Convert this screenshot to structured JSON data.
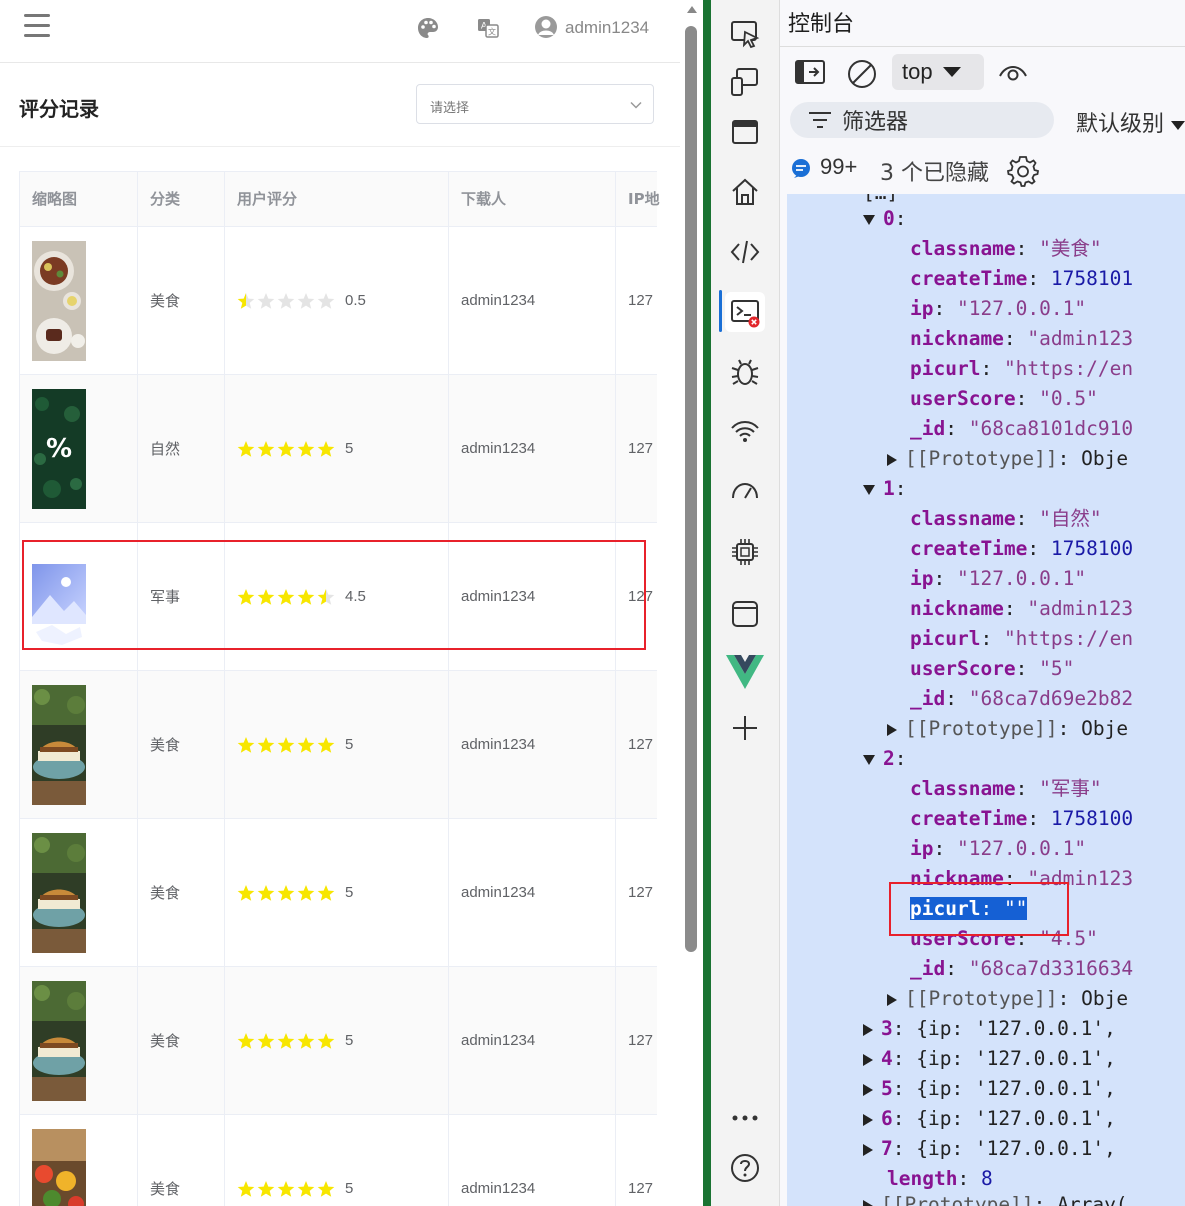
{
  "topbar": {
    "menu_icon": "hamburger-icon",
    "theme_icon": "palette-icon",
    "lang_icon": "translate-icon",
    "user_icon": "user-avatar-icon",
    "username": "admin1234"
  },
  "page": {
    "title": "评分记录",
    "filter_placeholder": "请选择"
  },
  "table": {
    "columns": [
      "缩略图",
      "分类",
      "用户评分",
      "下载人",
      "IP地"
    ],
    "rows": [
      {
        "category": "美食",
        "score": "0.5",
        "stars": 0.5,
        "downloader": "admin1234",
        "ip": "127",
        "thumb": "food"
      },
      {
        "category": "自然",
        "score": "5",
        "stars": 5,
        "downloader": "admin1234",
        "ip": "127",
        "thumb": "nature"
      },
      {
        "category": "军事",
        "score": "4.5",
        "stars": 4.5,
        "downloader": "admin1234",
        "ip": "127",
        "thumb": "placeholder"
      },
      {
        "category": "美食",
        "score": "5",
        "stars": 5,
        "downloader": "admin1234",
        "ip": "127",
        "thumb": "burger"
      },
      {
        "category": "美食",
        "score": "5",
        "stars": 5,
        "downloader": "admin1234",
        "ip": "127",
        "thumb": "burger"
      },
      {
        "category": "美食",
        "score": "5",
        "stars": 5,
        "downloader": "admin1234",
        "ip": "127",
        "thumb": "burger"
      },
      {
        "category": "美食",
        "score": "5",
        "stars": 5,
        "downloader": "admin1234",
        "ip": "127",
        "thumb": "veggies"
      }
    ]
  },
  "colors": {
    "star_on": "#f7e600",
    "star_off": "#e4e4e4",
    "highlight": "#e8212b",
    "devtools_accent": "#1a6fd6"
  },
  "devtools": {
    "title": "控制台",
    "context": "top",
    "filter_label": "筛选器",
    "level": "默认级别",
    "issues": "99+",
    "hidden": "3 个已隐藏",
    "activity_icons": [
      "inspect-icon",
      "device-icon",
      "panel-icon",
      "home-icon",
      "elements-icon",
      "console-icon",
      "bug-icon",
      "network-icon",
      "performance-icon",
      "memory-icon",
      "application-icon",
      "vue-icon",
      "add-icon",
      "more-icon",
      "help-icon"
    ],
    "console_lines": {
      "head": "[…] ",
      "i0": "0",
      "i1": "1",
      "i2": "2",
      "k_classname": "classname",
      "k_createTime": "createTime",
      "k_ip": "ip",
      "k_nickname": "nickname",
      "k_picurl": "picurl",
      "k_userScore": "userScore",
      "k_id": "_id",
      "proto": "[[Prototype]]",
      "proto_val": "Obje",
      "v0_classname": "\"美食\"",
      "v0_createTime": "1758101",
      "v0_ip": "\"127.0.0.1\"",
      "v0_nickname": "\"admin123",
      "v0_picurl": "\"https://en",
      "v0_userScore": "\"0.5\"",
      "v0_id": "\"68ca8101dc910",
      "v1_classname": "\"自然\"",
      "v1_createTime": "1758100",
      "v1_ip": "\"127.0.0.1\"",
      "v1_nickname": "\"admin123",
      "v1_picurl": "\"https://en",
      "v1_userScore": "\"5\"",
      "v1_id": "\"68ca7d69e2b82",
      "v2_classname": "\"军事\"",
      "v2_createTime": "1758100",
      "v2_ip": "\"127.0.0.1\"",
      "v2_nickname": "\"admin123",
      "v2_picurl": "\"\"",
      "v2_userScore": "\"4.5\"",
      "v2_id": "\"68ca7d3316634",
      "collapsed": [
        {
          "index": "3",
          "text": "{ip: '127.0.0.1',"
        },
        {
          "index": "4",
          "text": "{ip: '127.0.0.1',"
        },
        {
          "index": "5",
          "text": "{ip: '127.0.0.1',"
        },
        {
          "index": "6",
          "text": "{ip: '127.0.0.1',"
        },
        {
          "index": "7",
          "text": "{ip: '127.0.0.1',"
        }
      ],
      "length_key": "length",
      "length_val": "8",
      "tail_key": "[[Prototype]]",
      "tail_val": "Array("
    }
  }
}
